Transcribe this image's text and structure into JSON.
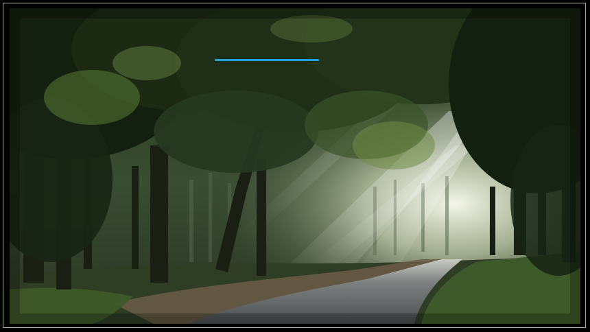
{
  "scene": {
    "subject": "forest-road-with-sunbeams",
    "colors": {
      "canopy_dark": "#14200f",
      "canopy_mid": "#2b3d22",
      "canopy_light": "#6f8a44",
      "sun_glow": "#f4f6ea",
      "road": "#5b5f60",
      "path_dirt": "#6a5c49",
      "grass": "#3f5a2a"
    }
  },
  "accent_line": {
    "color": "#1ea0d8"
  }
}
